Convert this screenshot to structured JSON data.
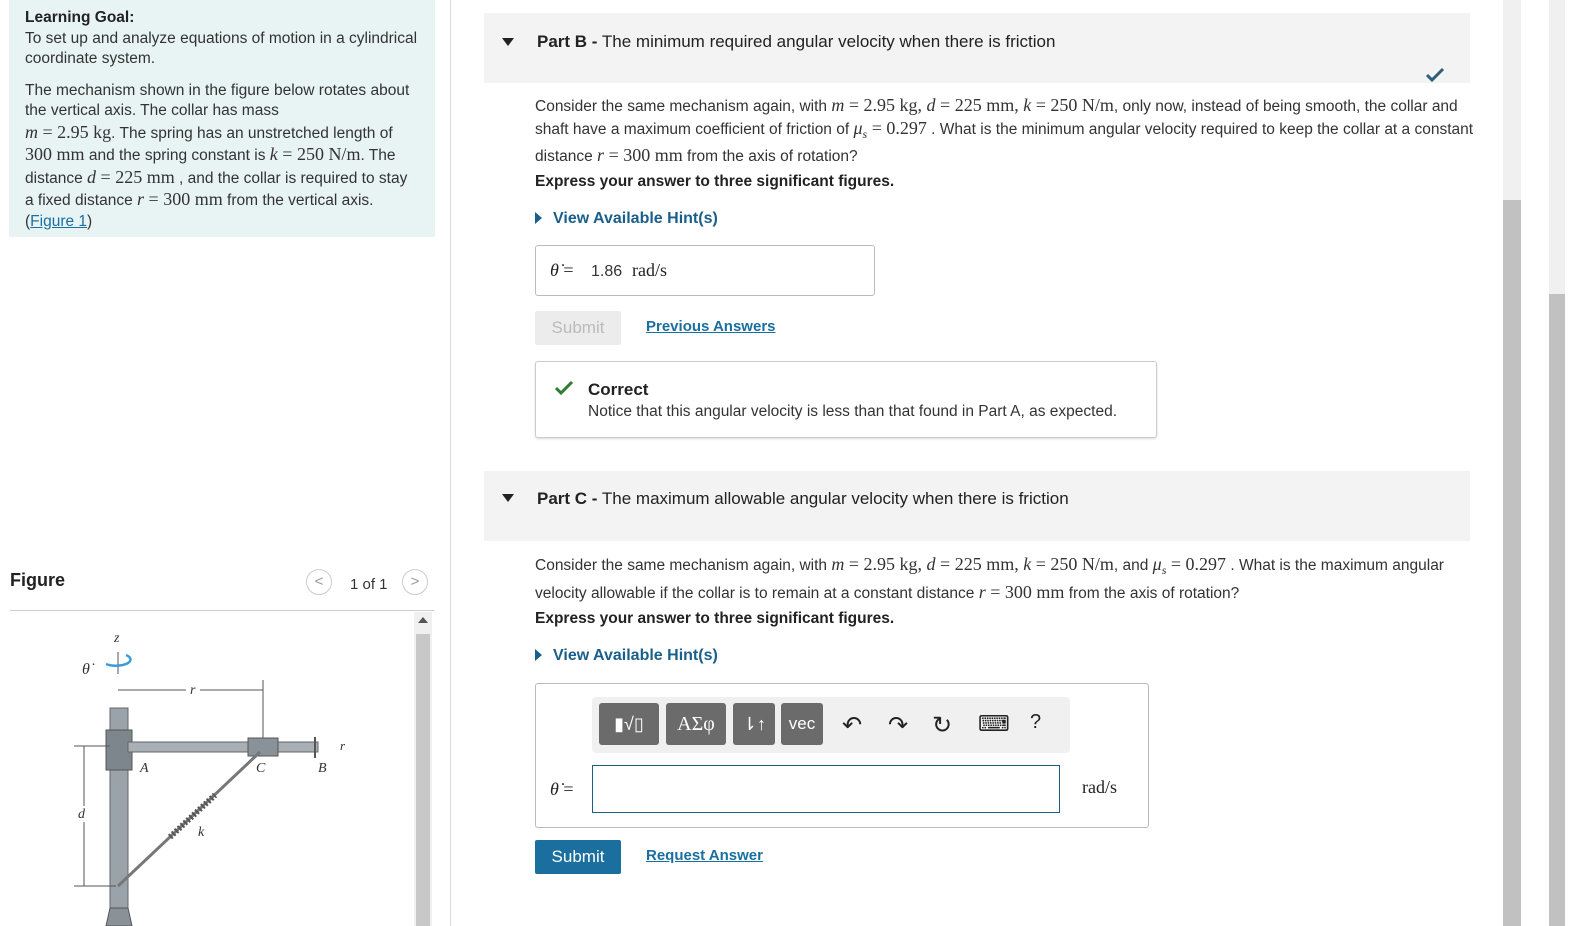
{
  "goal": {
    "heading": "Learning Goal:",
    "text": "To set up and analyze equations of motion in a cylindrical coordinate system.",
    "p1": "The mechanism shown in the figure below rotates about the vertical axis. The collar has mass",
    "m_sym": "m",
    "eq": " = ",
    "m_val": "2.95",
    "kg": " kg",
    "p2": ". The spring has an unstretched length of",
    "len_val": "300",
    "mm": " mm",
    "p3": " and the spring constant is",
    "k_sym": "k",
    "k_val": "250",
    "npm": " N/m",
    "p4": ". The distance",
    "d_sym": "d",
    "d_val": "225",
    "p5": " , and the collar is required to stay a fixed distance",
    "r_sym": "r",
    "r_val": "300",
    "p6": " from the vertical axis.(",
    "fig_link": "Figure 1",
    "p7": ")"
  },
  "figure": {
    "title": "Figure",
    "prev": "<",
    "next": ">",
    "count": "1 of 1",
    "labels": {
      "z": "z",
      "theta": "θ̇",
      "r": "r",
      "A": "A",
      "B": "B",
      "C": "C",
      "d": "d",
      "k": "k",
      "r2": "r"
    }
  },
  "partB": {
    "label": "Part B -",
    "title": " The minimum required angular velocity when there is friction",
    "q_a": "Consider the same mechanism again, with ",
    "q_b": ", only now, instead of being smooth, the collar and shaft have a maximum coefficient of friction of ",
    "mu_sym": "μ",
    "mu_sub": "s",
    "mu_val": "0.297",
    "q_c": " . What is the minimum angular velocity required to keep the collar at a constant distance ",
    "q_d": " from the axis of rotation?",
    "sep": ", ",
    "express": "Express your answer to three significant figures.",
    "hint": "View Available Hint(s)",
    "theta_dot": "θ̇",
    "eqs": " = ",
    "answer": "1.86",
    "unit": "rad/s",
    "submit": "Submit",
    "prev_answers": "Previous Answers",
    "correct_title": "Correct",
    "correct_msg": "Notice that this angular velocity is less than that found in Part A, as expected."
  },
  "partC": {
    "label": "Part C -",
    "title": " The maximum allowable angular velocity when there is friction",
    "q_a": "Consider the same mechanism again, with ",
    "q_b": ", and ",
    "q_c": " . What is the maximum angular velocity allowable if the collar is to remain at a constant distance ",
    "q_d": " from the axis of rotation?",
    "express": "Express your answer to three significant figures.",
    "hint": "View Available Hint(s)",
    "toolbar": {
      "templates": "▮√▯",
      "greek": "ΑΣφ",
      "arrows": "⇂↑",
      "vec": "vec",
      "undo": "↶",
      "redo": "↷",
      "reset": "↻",
      "keyboard": "⌨",
      "help": "?"
    },
    "theta_dot": "θ̇",
    "eqs": " =",
    "input_value": "",
    "unit": "rad/s",
    "submit": "Submit",
    "request": "Request Answer"
  },
  "colors": {
    "accent": "#1a6f9e",
    "check": "#2e7d32",
    "goal_bg": "#e8f4f4"
  }
}
